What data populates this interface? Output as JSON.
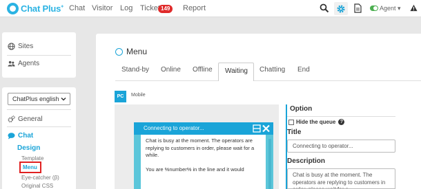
{
  "brand": {
    "name": "Chat Plus",
    "mark": "+"
  },
  "nav": {
    "items": [
      "Chat",
      "Visitor",
      "Log",
      "Ticket",
      "Report"
    ],
    "ticket_count": "149"
  },
  "topbar": {
    "agent_label": "Agent",
    "icons": [
      "search-icon",
      "gear-icon",
      "document-icon",
      "warning-icon"
    ]
  },
  "sidebar": {
    "sites": "Sites",
    "agents": "Agents",
    "site_select": "ChatPlus english",
    "general": "General",
    "chat": "Chat",
    "design": "Design",
    "template": "Template",
    "menu": "Menu",
    "eye_catcher": "Eye-catcher (β)",
    "original_css": "Original CSS"
  },
  "main": {
    "title": "Menu",
    "tabs": [
      "Stand-by",
      "Online",
      "Offline",
      "Waiting",
      "Chatting",
      "End"
    ],
    "active_tab": "Waiting",
    "device_pc": "PC",
    "device_mobile": "Mobile"
  },
  "preview": {
    "header": "Connecting to operator...",
    "busy_message": "Chat is busy at the moment. The operators are replying to customers in order, please wait for a while.",
    "queue_message": "You are %number% in the line and it would"
  },
  "options": {
    "heading": "Option",
    "hide_queue": "Hide the queue",
    "title_label": "Title",
    "title_value": "Connecting to operator...",
    "desc_label": "Description",
    "desc_value": "Chat is busy at the moment. The operators are replying to customers in order, please wait for a"
  },
  "colors": {
    "accent": "#1aa4d8",
    "widget_bg": "#5cc6da",
    "badge": "#e02b2b",
    "highlight": "#e02020"
  }
}
